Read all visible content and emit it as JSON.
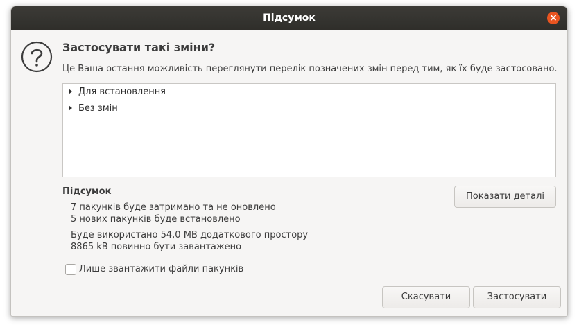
{
  "window": {
    "title": "Підсумок",
    "close_glyph": "×"
  },
  "dialog": {
    "icon": "question-icon",
    "heading": "Застосувати такі зміни?",
    "description": "Це Ваша остання можливість переглянути перелік позначених змін перед тим, як їх буде застосовано."
  },
  "tree": {
    "items": [
      {
        "label": "Для встановлення"
      },
      {
        "label": "Без змін"
      }
    ]
  },
  "summary": {
    "title": "Підсумок",
    "lines": [
      "7 пакунків буде затримано та не оновлено",
      "5 нових пакунків буде встановлено",
      "Буде використано 54,0 MB додаткового простору",
      "8865 kB повинно бути завантажено"
    ],
    "details_label": "Показати деталі"
  },
  "download_only": {
    "label": "Лише звантажити файли пакунків",
    "checked": false
  },
  "buttons": {
    "cancel": "Скасувати",
    "apply": "Застосувати"
  },
  "colors": {
    "titlebar": "#3c3b37",
    "close_button": "#e95420",
    "background": "#f6f5f4"
  }
}
